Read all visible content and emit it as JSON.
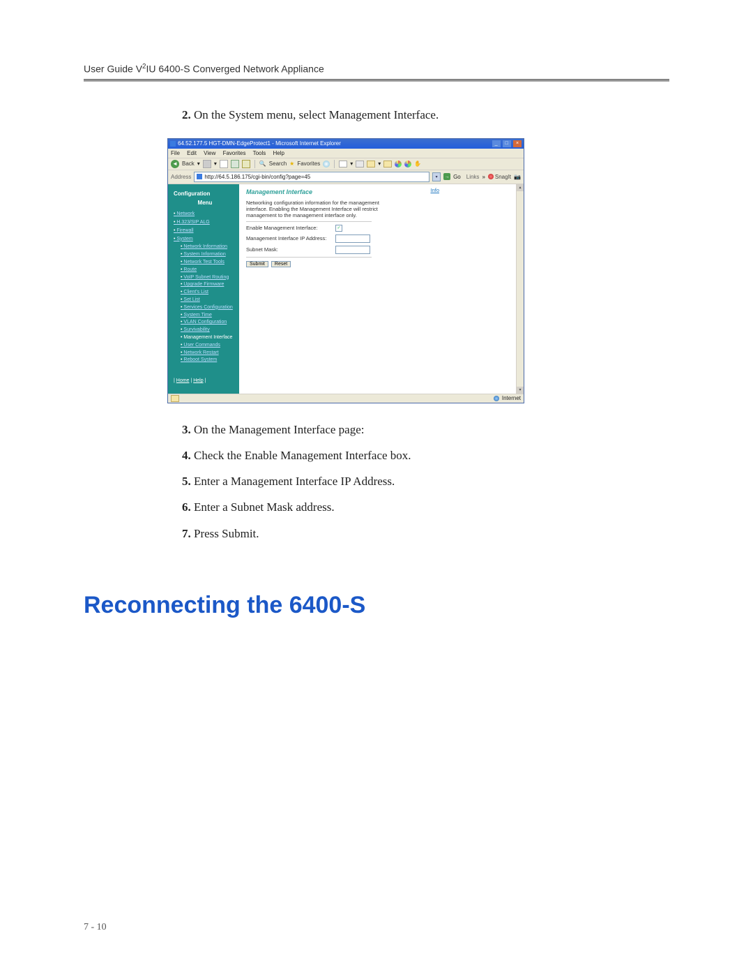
{
  "running_header": "User Guide V²IU 6400-S Converged Network Appliance",
  "steps_a": [
    "On the System menu, select Management Interface."
  ],
  "steps_b": [
    "On the Management Interface page:",
    "Check the Enable Management Interface box.",
    "Enter a Management Interface IP Address.",
    "Enter a Subnet Mask address.",
    "Press Submit."
  ],
  "section_heading": "Reconnecting the 6400-S",
  "page_number": "7 - 10",
  "ie": {
    "title": "64.52.177.5 HGT-DMN-EdgeProtect1 - Microsoft Internet Explorer",
    "menus": [
      "File",
      "Edit",
      "View",
      "Favorites",
      "Tools",
      "Help"
    ],
    "back": "Back",
    "search": "Search",
    "favorites": "Favorites",
    "address_label": "Address",
    "url": "http://64.5.186.175/cgi-bin/config?page=45",
    "go": "Go",
    "links": "Links",
    "snagit": "SnagIt",
    "status": "Internet",
    "sidebar": {
      "title1": "Configuration",
      "title2": "Menu",
      "top": [
        "Network",
        "H.323/SIP ALG",
        "Firewall",
        "System"
      ],
      "sub": [
        "Network Information",
        "System Information",
        "Network Test Tools",
        "Route",
        "VoIP Subnet Routing",
        "Upgrade Firmware",
        "Client's List",
        "Set List",
        "Services Configuration",
        "System Time",
        "VLAN Configuration",
        "Survivability",
        "Management Interface",
        "User Commands",
        "Network Restart",
        "Reboot System"
      ],
      "home": "Home",
      "help": "Help"
    },
    "main": {
      "info": "Info",
      "heading": "Management Interface",
      "desc": "Networking configuration information for the management interface. Enabling the Management Interface will restrict management to the management interface only.",
      "enable_label": "Enable Management Interface:",
      "ip_label": "Management Interface IP Address:",
      "mask_label": "Subnet Mask:",
      "submit": "Submit",
      "reset": "Reset"
    }
  }
}
